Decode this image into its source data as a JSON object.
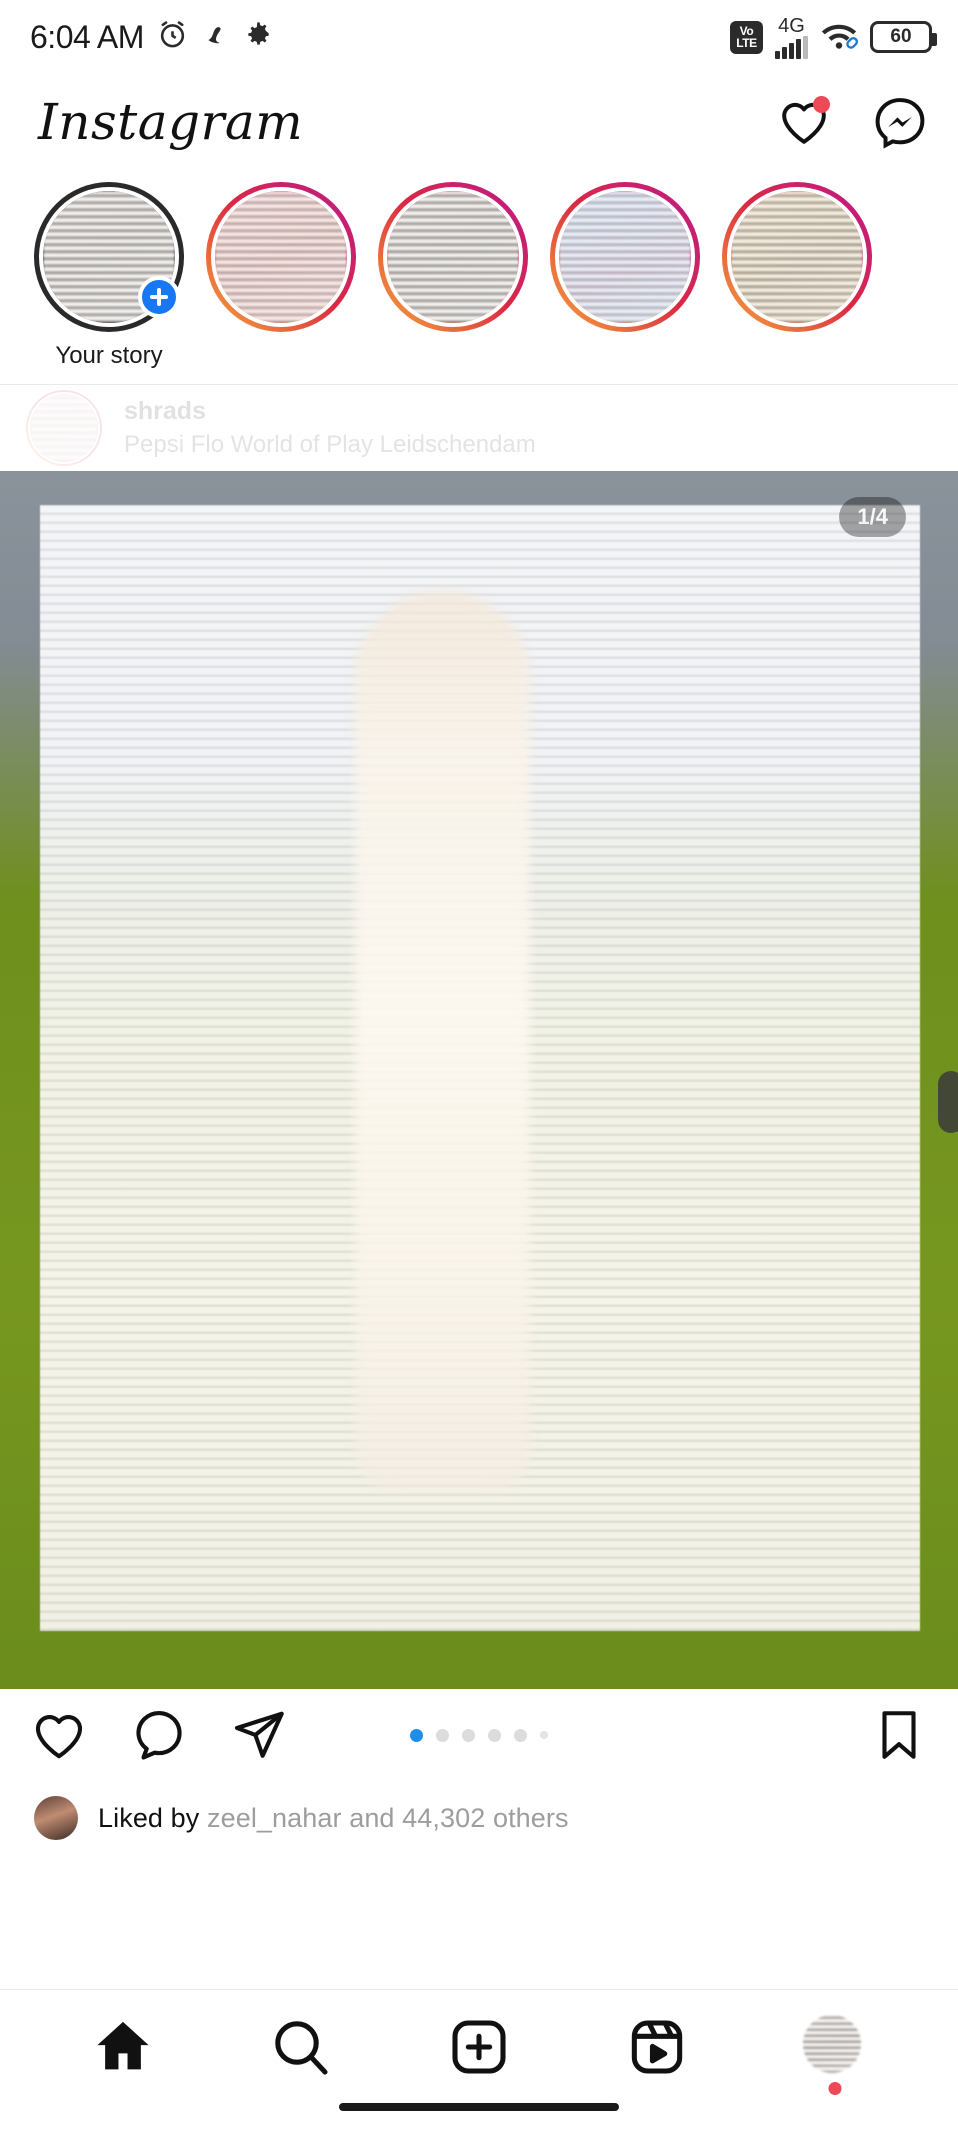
{
  "status_bar": {
    "time": "6:04 AM",
    "alarm_icon": "alarm-clock-icon",
    "app_icon": "app-badge-icon",
    "settings_icon": "gear-icon",
    "volte_top": "Vo",
    "volte_bottom": "LTE",
    "network_type": "4G",
    "signal_icon": "signal-bars-icon",
    "wifi_icon": "wifi-icon",
    "battery_level": "60"
  },
  "app_header": {
    "logo_text": "Instagram",
    "activity_icon": "heart-icon",
    "activity_has_badge": true,
    "messenger_icon": "messenger-icon"
  },
  "stories": {
    "items": [
      {
        "label": "Your story",
        "own": true,
        "has_ring": false,
        "tone": "grey"
      },
      {
        "label": "",
        "own": false,
        "has_ring": true,
        "tone": "pinkish"
      },
      {
        "label": "",
        "own": false,
        "has_ring": true,
        "tone": "grey"
      },
      {
        "label": "",
        "own": false,
        "has_ring": true,
        "tone": "bluish"
      },
      {
        "label": "",
        "own": false,
        "has_ring": true,
        "tone": "golden"
      }
    ],
    "add_story_icon": "plus-badge-icon"
  },
  "post": {
    "username": "shrads",
    "location": "Pepsi Flo World of Play Leidschendam",
    "menu_icon": "more-options-icon",
    "carousel_counter": "1/4",
    "carousel_total_dots": 6,
    "carousel_active_index": 0,
    "like_icon": "heart-icon",
    "comment_icon": "comment-bubble-icon",
    "share_icon": "share-paperplane-icon",
    "save_icon": "bookmark-icon",
    "likes_prefix": "Liked by",
    "likes_username": "zeel_nahar",
    "likes_middle": "and",
    "likes_count": "44,302",
    "likes_suffix": "others"
  },
  "bottom_nav": {
    "items": [
      {
        "name": "home",
        "icon": "home-icon",
        "active": true
      },
      {
        "name": "search",
        "icon": "search-icon",
        "active": false
      },
      {
        "name": "create",
        "icon": "plus-square-icon",
        "active": false
      },
      {
        "name": "reels",
        "icon": "reels-icon",
        "active": false
      },
      {
        "name": "profile",
        "icon": "profile-avatar-icon",
        "active": false,
        "has_badge": true
      }
    ]
  },
  "colors": {
    "accent_blue": "#1E8EE8",
    "notification_red": "#ED4956",
    "story_gradient_start": "#F9A341",
    "story_gradient_end": "#BC1888",
    "grass_green": "#6F8F1E",
    "sky_grey": "#8A929B"
  }
}
